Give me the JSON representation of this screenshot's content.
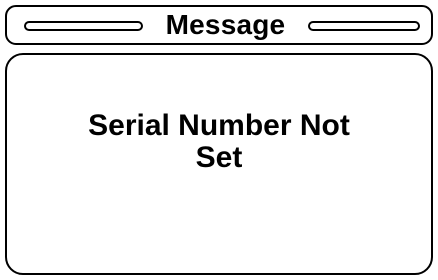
{
  "window": {
    "title": "Message"
  },
  "message": {
    "lines": [
      "Serial Number Not",
      "Set"
    ]
  }
}
